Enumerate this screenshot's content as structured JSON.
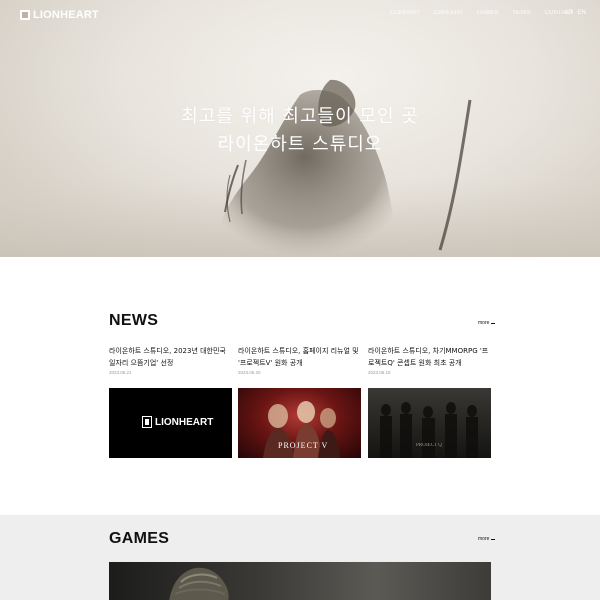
{
  "header": {
    "logo_text": "LIONHEART",
    "nav": [
      "COMPANY",
      "CAREERS",
      "GAMES",
      "NEWS",
      "CONTACT"
    ],
    "lang": [
      "KR",
      "EN"
    ]
  },
  "hero": {
    "line1": "최고를 위해 최고들이 모인 곳",
    "line2": "라이온하트 스튜디오"
  },
  "news": {
    "title": "NEWS",
    "more_label": "more",
    "items": [
      {
        "title": "라이온하트 스튜디오, 2023년 대한민국 일자리 으뜸기업' 선정",
        "date": "2023.06.21",
        "thumb_text": "LIONHEART"
      },
      {
        "title": "라이온하트 스튜디오, 홈페이지 리뉴얼 및 '프로젝트V' 원화 공개",
        "date": "2023.06.20",
        "thumb_text": "PROJECT V"
      },
      {
        "title": "라이온하트 스튜디오, 차기MMORPG '프로젝트Q' 콘셉트 원화 최초 공개",
        "date": "2023.06.15",
        "thumb_text": "PROJECT Q"
      }
    ]
  },
  "games": {
    "title": "GAMES",
    "more_label": "more"
  },
  "colors": {
    "accent": "#111111",
    "news_bg": "#ffffff",
    "games_bg": "#eeeeee"
  }
}
